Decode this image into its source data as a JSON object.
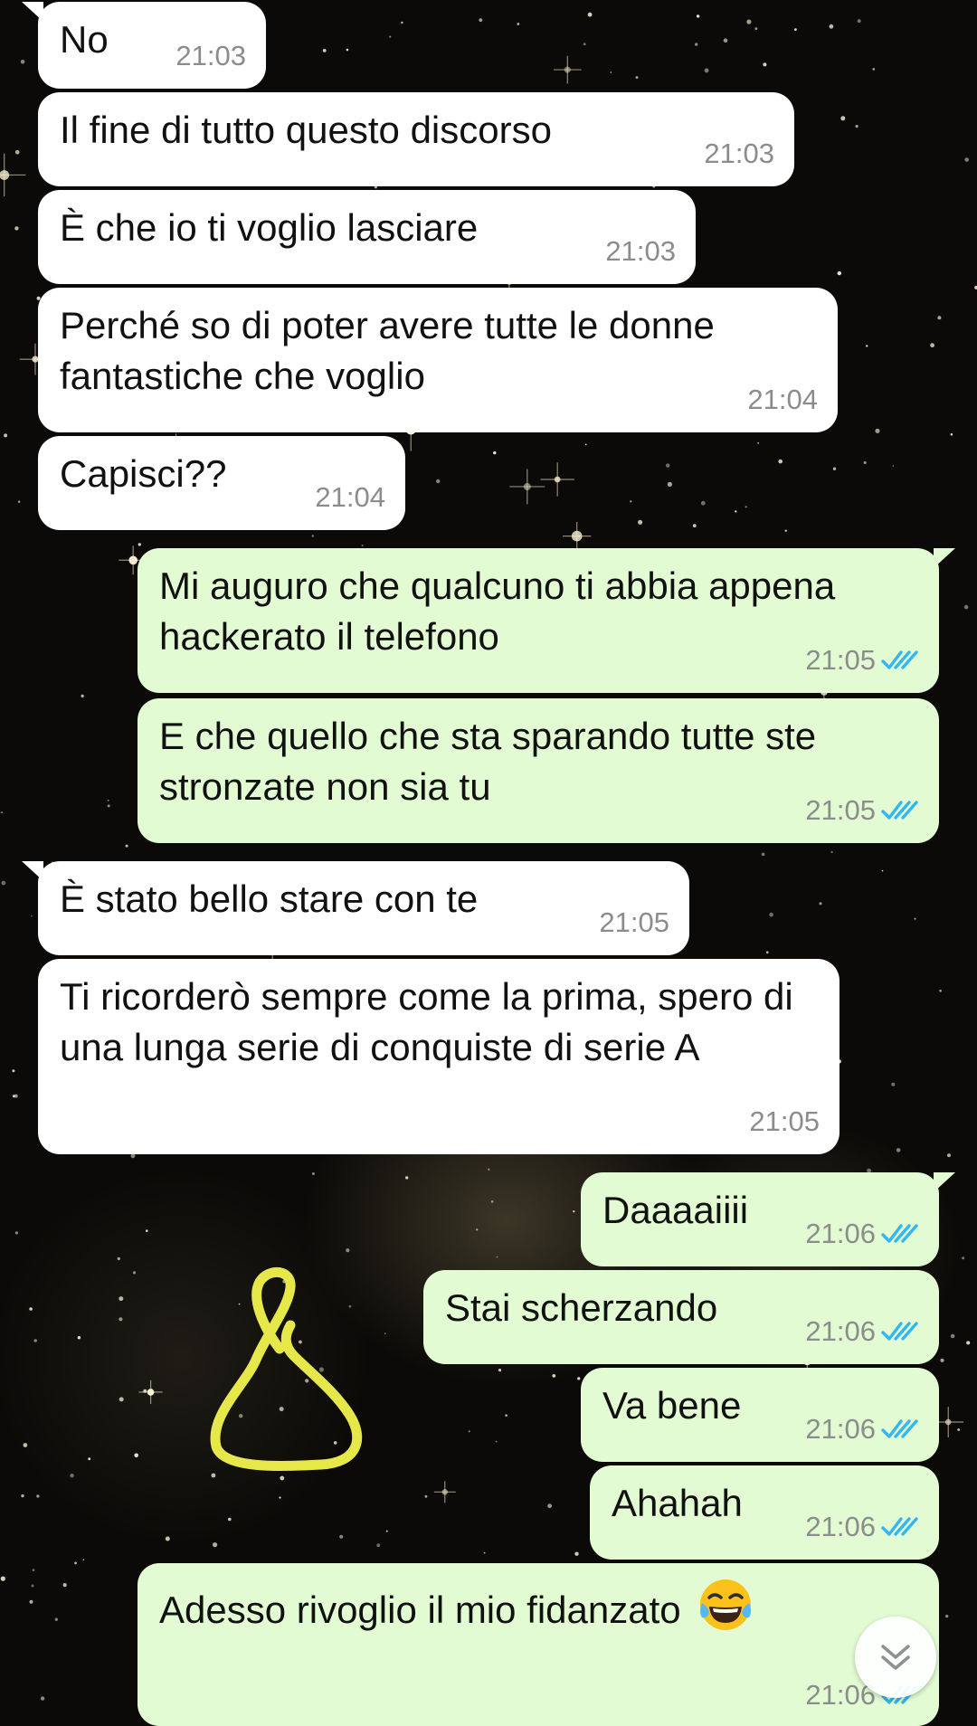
{
  "chat": {
    "messages": [
      {
        "text": "No",
        "time": "21:03",
        "direction": "incoming",
        "read": false
      },
      {
        "text": "Il fine di tutto questo discorso",
        "time": "21:03",
        "direction": "incoming",
        "read": false
      },
      {
        "text": "È che io ti voglio lasciare",
        "time": "21:03",
        "direction": "incoming",
        "read": false
      },
      {
        "text": "Perché so di poter avere tutte le donne fantastiche che voglio",
        "time": "21:04",
        "direction": "incoming",
        "read": false
      },
      {
        "text": "Capisci??",
        "time": "21:04",
        "direction": "incoming",
        "read": false
      },
      {
        "text": "Mi auguro che qualcuno ti abbia appena hackerato il telefono",
        "time": "21:05",
        "direction": "outgoing",
        "read": true
      },
      {
        "text": "E che quello che sta sparando tutte ste stronzate non sia tu",
        "time": "21:05",
        "direction": "outgoing",
        "read": true
      },
      {
        "text": "È stato bello stare con te",
        "time": "21:05",
        "direction": "incoming",
        "read": false
      },
      {
        "text": "Ti ricorderò sempre come la prima, spero di una lunga serie di conquiste di serie A",
        "time": "21:05",
        "direction": "incoming",
        "read": false
      },
      {
        "text": "Daaaaiiii",
        "time": "21:06",
        "direction": "outgoing",
        "read": true
      },
      {
        "text": "Stai scherzando",
        "time": "21:06",
        "direction": "outgoing",
        "read": true
      },
      {
        "text": "Va bene",
        "time": "21:06",
        "direction": "outgoing",
        "read": true
      },
      {
        "text": "Ahahah",
        "time": "21:06",
        "direction": "outgoing",
        "read": true
      },
      {
        "text": "Adesso rivoglio il mio fidanzato",
        "time": "21:06",
        "direction": "outgoing",
        "read": true,
        "emoji": "tears-of-joy-emoji"
      }
    ]
  },
  "icons": {
    "read_receipt": "double-check-icon",
    "scroll_down": "chevron-double-down-icon",
    "doodle": "hand-drawn-doodle"
  },
  "colors": {
    "incoming_bubble": "#ffffff",
    "outgoing_bubble": "#e2fbd3",
    "timestamp": "#8b8d8a",
    "read_tick": "#34b7f1",
    "doodle": "#e6e84a"
  }
}
